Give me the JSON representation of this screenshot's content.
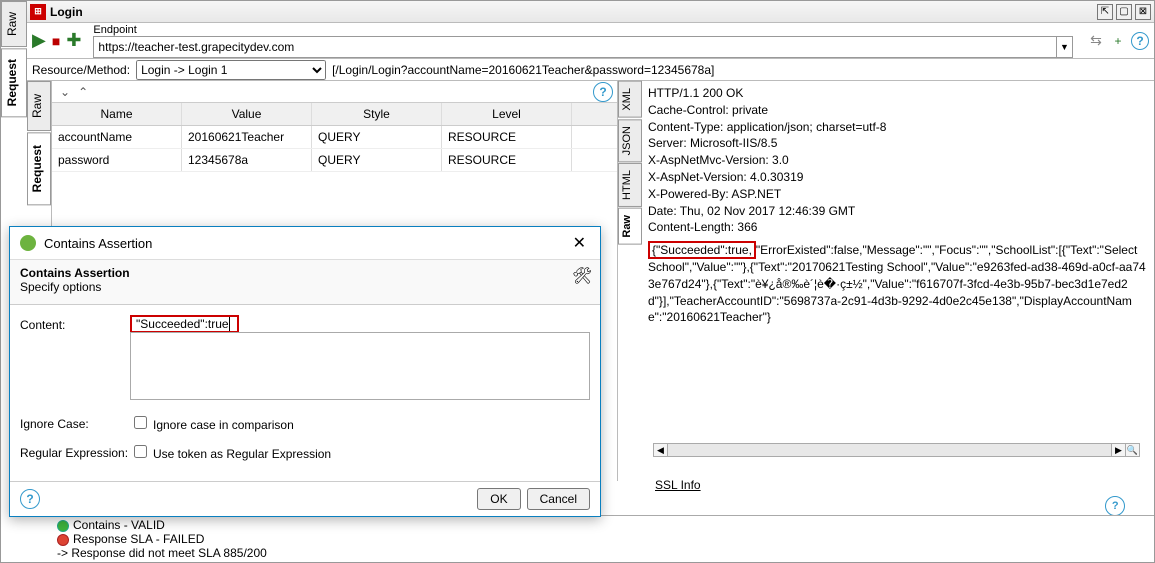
{
  "window": {
    "title": "Login"
  },
  "vert_tabs_outer": [
    "Raw",
    "Request"
  ],
  "toolbar": {
    "endpoint_label": "Endpoint",
    "endpoint_value": "https://teacher-test.grapecitydev.com",
    "resource_method_label": "Resource/Method:",
    "resource_method_value": "Login -> Login 1",
    "path_preview": "[/Login/Login?accountName=20160621Teacher&password=12345678a]"
  },
  "param_tabs_left": [
    "Raw",
    "Request"
  ],
  "param_table": {
    "headers": {
      "name": "Name",
      "value": "Value",
      "style": "Style",
      "level": "Level"
    },
    "rows": [
      {
        "name": "accountName",
        "value": "20160621Teacher",
        "style": "QUERY",
        "level": "RESOURCE"
      },
      {
        "name": "password",
        "value": "12345678a",
        "style": "QUERY",
        "level": "RESOURCE"
      }
    ]
  },
  "response_tabs": [
    "XML",
    "JSON",
    "HTML",
    "Raw"
  ],
  "response_headers": [
    "HTTP/1.1 200 OK",
    "Cache-Control: private",
    "Content-Type: application/json; charset=utf-8",
    "Server: Microsoft-IIS/8.5",
    "X-AspNetMvc-Version: 3.0",
    "X-AspNet-Version: 4.0.30319",
    "X-Powered-By: ASP.NET",
    "Date: Thu, 02 Nov 2017 12:46:39 GMT",
    "Content-Length: 366"
  ],
  "response_body": {
    "hi": "{\"Succeeded\":true,",
    "rest": "\"ErrorExisted\":false,\"Message\":\"\",\"Focus\":\"\",\"SchoolList\":[{\"Text\":\"Select School\",\"Value\":\"\"},{\"Text\":\"20170621Testing School\",\"Value\":\"e9263fed-ad38-469d-a0cf-aa743e767d24\"},{\"Text\":\"è¥¿å®‰è´¦è�·ç±½\",\"Value\":\"f616707f-3fcd-4e3b-95b7-bec3d1e7ed2d\"}],\"TeacherAccountID\":\"5698737a-2c91-4d3b-9292-4d0e2c45e138\",\"DisplayAccountName\":\"20160621Teacher\"}"
  },
  "ssl_label": "SSL Info",
  "online_help": "Online Help",
  "dialog": {
    "title": "Contains Assertion",
    "subtitle": "Contains Assertion",
    "desc": "Specify options",
    "content_label": "Content:",
    "content_value": "\"Succeeded\":true",
    "ignore_label": "Ignore Case:",
    "ignore_option": "Ignore case in comparison",
    "regex_label": "Regular Expression:",
    "regex_option": "Use token as Regular Expression",
    "ok": "OK",
    "cancel": "Cancel"
  },
  "assertions": {
    "a1": "Contains - VALID",
    "a2": "Response SLA - FAILED",
    "a3": "-> Response did not meet SLA 885/200"
  }
}
